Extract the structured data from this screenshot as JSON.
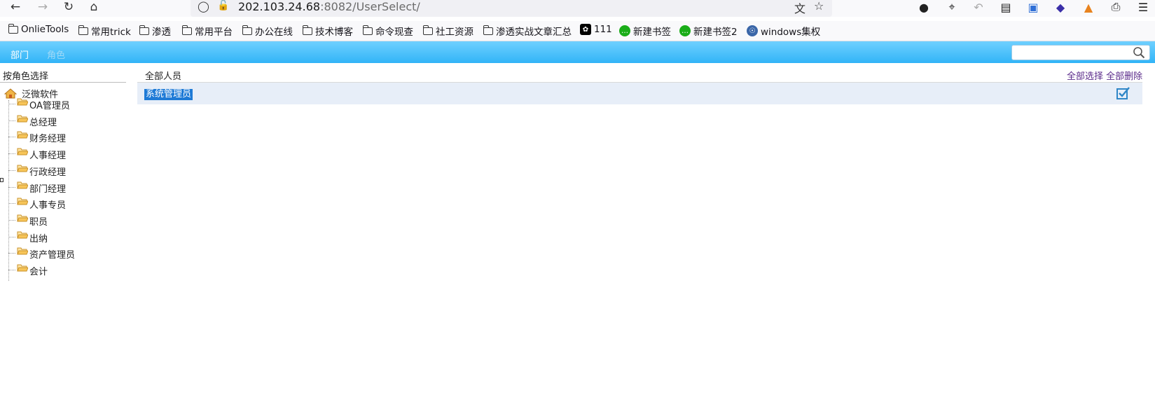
{
  "browser": {
    "url_host": "202.103.24.68",
    "url_rest": ":8082/UserSelect/"
  },
  "bookmarks": [
    {
      "label": "OnlieTools",
      "icon": "folder-icon"
    },
    {
      "label": "常用trick",
      "icon": "folder-icon"
    },
    {
      "label": "渗透",
      "icon": "folder-icon"
    },
    {
      "label": "常用平台",
      "icon": "folder-icon"
    },
    {
      "label": "办公在线",
      "icon": "folder-icon"
    },
    {
      "label": "技术博客",
      "icon": "folder-icon"
    },
    {
      "label": "命令现查",
      "icon": "folder-icon"
    },
    {
      "label": "社工资源",
      "icon": "folder-icon"
    },
    {
      "label": "渗透实战文章汇总",
      "icon": "folder-icon"
    },
    {
      "label": "111",
      "icon": "openai-icon"
    },
    {
      "label": "新建书签",
      "icon": "wechat-icon"
    },
    {
      "label": "新建书签2",
      "icon": "wechat-icon"
    },
    {
      "label": "windows集权",
      "icon": "globe-icon"
    }
  ],
  "app": {
    "tabs": [
      {
        "label": "部门",
        "active": true
      },
      {
        "label": "角色",
        "active": false
      }
    ],
    "search": {
      "value": "",
      "placeholder": ""
    },
    "accent_color": "#31b4f7"
  },
  "left_panel": {
    "title": "按角色选择",
    "root": "泛微软件",
    "roles": [
      "OA管理员",
      "总经理",
      "财务经理",
      "人事经理",
      "行政经理",
      "部门经理",
      "人事专员",
      "职员",
      "出纳",
      "资产管理员",
      "会计"
    ]
  },
  "main_panel": {
    "title": "全部人员",
    "select_all": "全部选择",
    "delete_all": "全部删除",
    "rows": [
      {
        "name": "系统管理员",
        "checked": true
      }
    ]
  }
}
